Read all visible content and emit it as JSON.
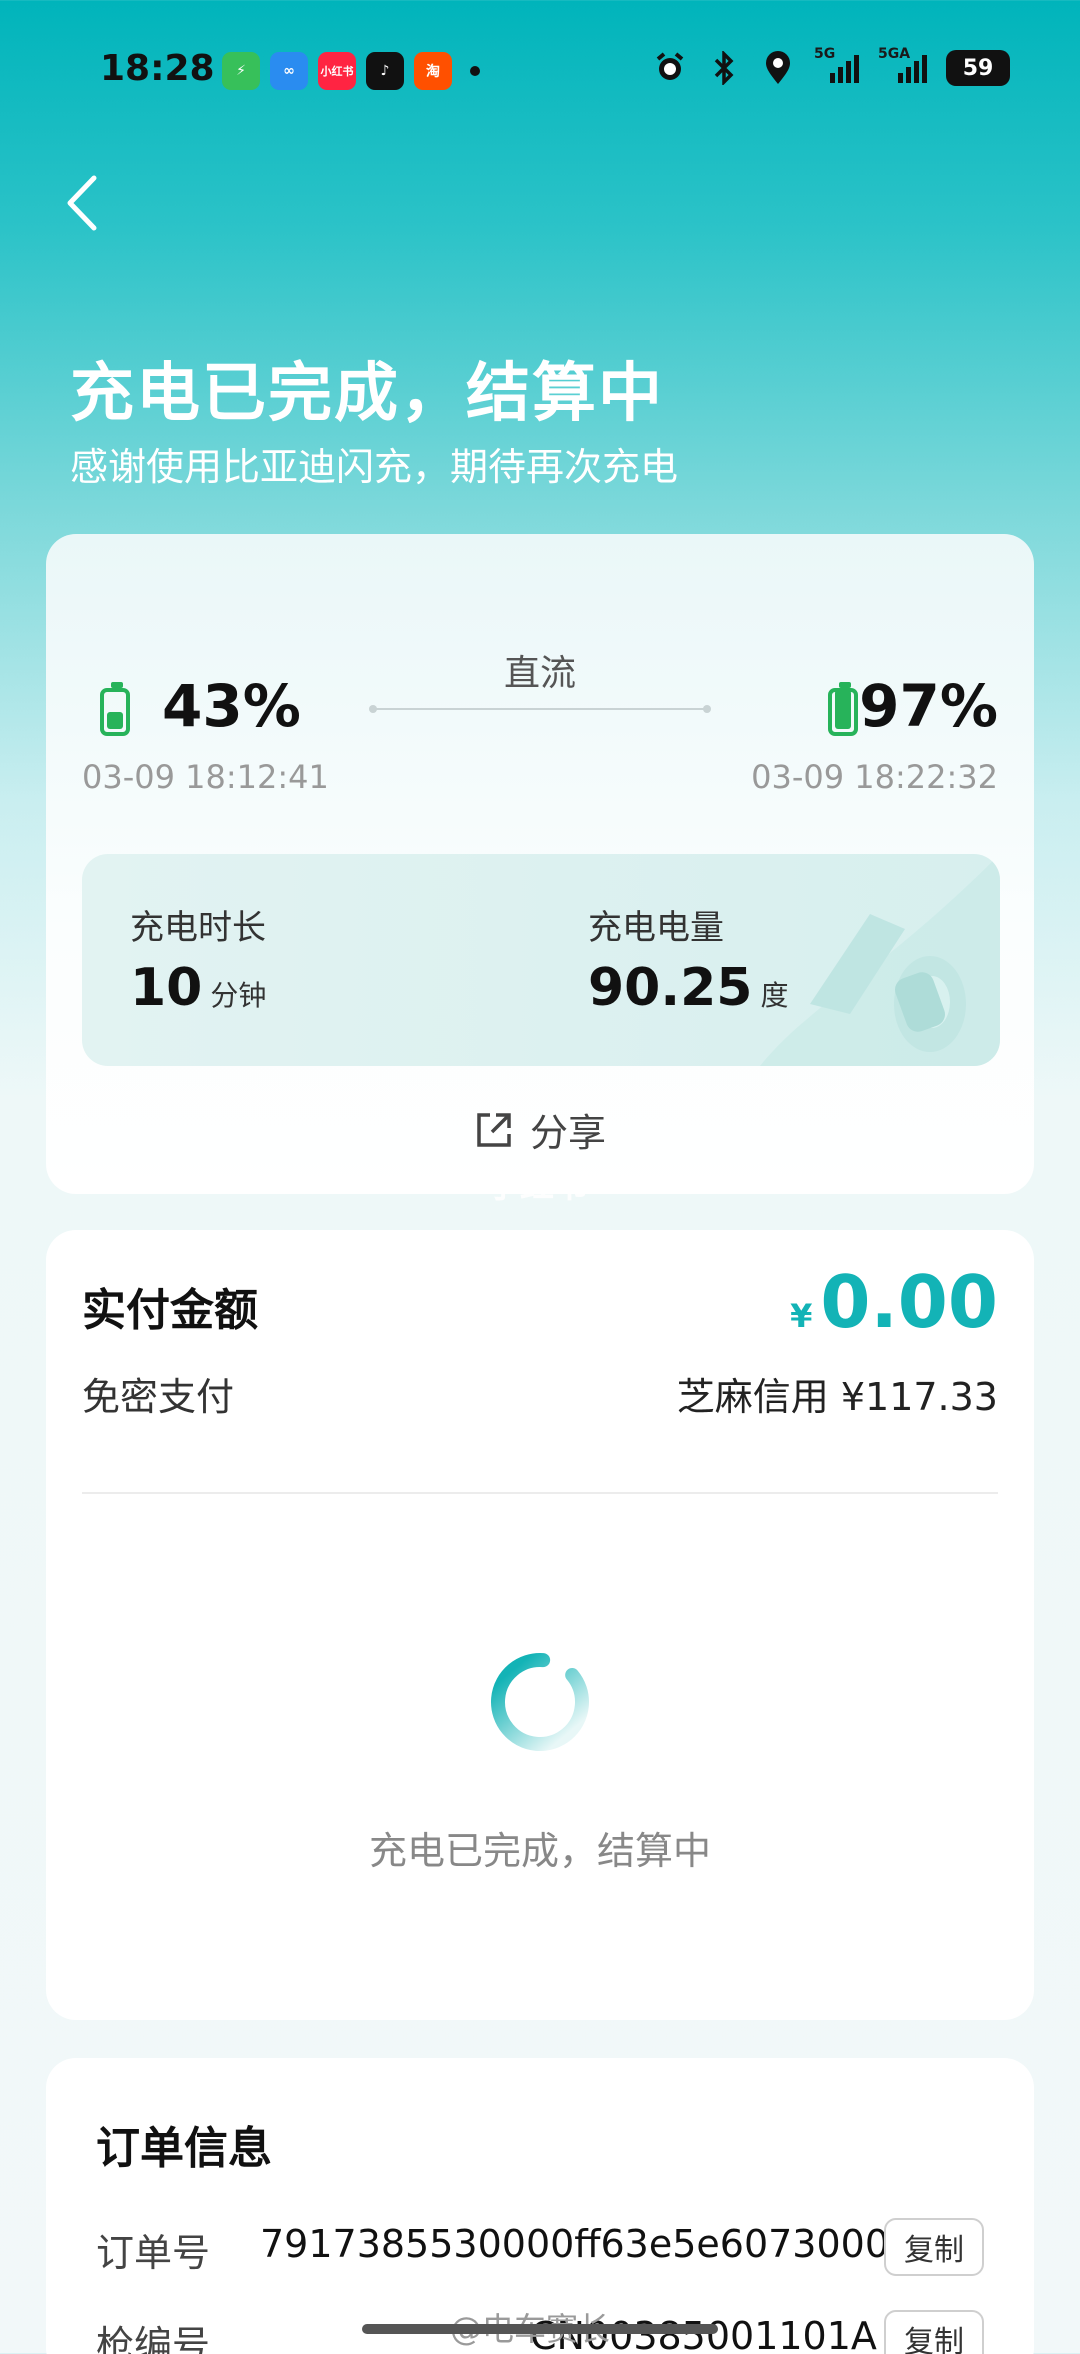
{
  "statusbar": {
    "time": "18:28",
    "apps": [
      {
        "name": "security",
        "color": "#37c05a",
        "label": "⚡"
      },
      {
        "name": "cloud",
        "color": "#2a8cf0",
        "label": "∞"
      },
      {
        "name": "xiaohongshu",
        "color": "#ff2442",
        "label": "小红书"
      },
      {
        "name": "tiktok",
        "color": "#111111",
        "label": "♪"
      },
      {
        "name": "taobao",
        "color": "#ff5000",
        "label": "淘"
      }
    ],
    "signal1": "5G",
    "signal2": "5GA",
    "battery": "59"
  },
  "header": {
    "title": "充电已完成，结算中",
    "subtitle": "感谢使用比亚迪闪充，期待再次充电"
  },
  "charge": {
    "mode": "直流",
    "start_pct": "43%",
    "end_pct": "97%",
    "start_fill": 0.43,
    "end_fill": 0.97,
    "start_time": "03-09 18:12:41",
    "end_time": "03-09 18:22:32",
    "duration_label": "充电时长",
    "duration_value": "10",
    "duration_unit": "分钟",
    "energy_label": "充电电量",
    "energy_value": "90.25",
    "energy_unit": "度",
    "share_label": "分享"
  },
  "payment": {
    "title": "实付金额",
    "currency": "¥",
    "amount": "0.00",
    "method": "免密支付",
    "credit": "芝麻信用  ¥117.33",
    "status": "充电已完成，结算中"
  },
  "order": {
    "title": "订单信息",
    "order_label": "订单号",
    "order_no": "7917385530000ff63e5e6073000",
    "gun_label": "枪编号",
    "gun_no": "CN00385001101A",
    "copy": "复制"
  },
  "watermarks": {
    "mid": "小红书",
    "bottom": "@电车赛长"
  },
  "colors": {
    "accent": "#13b3b6",
    "battery_green": "#27b35a"
  }
}
